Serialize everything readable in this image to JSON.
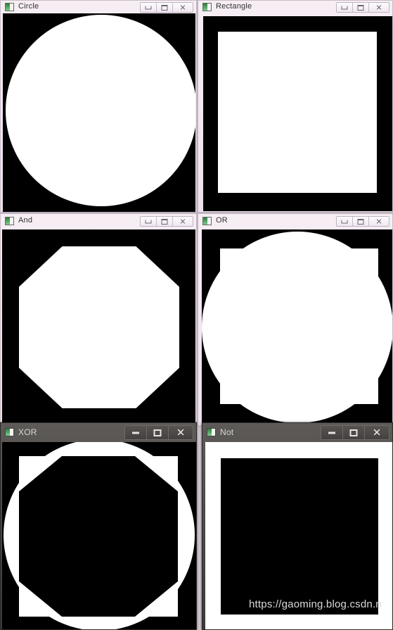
{
  "desktop": {
    "background_color": "#cfc6cf",
    "gap_color": "#bdb2bd"
  },
  "watermark": {
    "text": "https://gaoming.blog.csdn.n",
    "color": "#d9d9d9"
  },
  "caption_glyphs": {
    "minimize": "minimize-icon",
    "maximize": "maximize-icon",
    "close": "✕"
  },
  "windows": [
    {
      "id": "circle",
      "title": "Circle",
      "icon": "image-window-icon",
      "state": "inactive",
      "theme": "light",
      "canvas_background": "#000000",
      "shape": {
        "kind": "circle",
        "fill": "#ffffff"
      },
      "buttons": {
        "minimize": "Minimize",
        "maximize": "Maximize",
        "close": "Close"
      }
    },
    {
      "id": "rectangle",
      "title": "Rectangle",
      "icon": "image-window-icon",
      "state": "inactive",
      "theme": "light",
      "canvas_background": "#000000",
      "shape": {
        "kind": "rectangle",
        "fill": "#ffffff"
      },
      "buttons": {
        "minimize": "Minimize",
        "maximize": "Maximize",
        "close": "Close"
      }
    },
    {
      "id": "and",
      "title": "And",
      "icon": "image-window-icon",
      "state": "inactive",
      "theme": "light",
      "canvas_background": "#000000",
      "shape": {
        "kind": "intersection",
        "fill": "#ffffff"
      },
      "buttons": {
        "minimize": "Minimize",
        "maximize": "Maximize",
        "close": "Close"
      }
    },
    {
      "id": "or",
      "title": "OR",
      "icon": "image-window-icon",
      "state": "inactive",
      "theme": "light",
      "canvas_background": "#000000",
      "shape": {
        "kind": "union",
        "fill": "#ffffff"
      },
      "buttons": {
        "minimize": "Minimize",
        "maximize": "Maximize",
        "close": "Close"
      }
    },
    {
      "id": "xor",
      "title": "XOR",
      "icon": "image-window-icon",
      "state": "active",
      "theme": "dark",
      "canvas_background": "#000000",
      "shape": {
        "kind": "symmetric-difference",
        "fill": "#ffffff"
      },
      "buttons": {
        "minimize": "Minimize",
        "maximize": "Maximize",
        "close": "Close"
      }
    },
    {
      "id": "not",
      "title": "Not",
      "icon": "image-window-icon",
      "state": "active",
      "theme": "dark",
      "canvas_background": "#ffffff",
      "shape": {
        "kind": "inverted-rectangle",
        "fill": "#000000"
      },
      "buttons": {
        "minimize": "Minimize",
        "maximize": "Maximize",
        "close": "Close"
      }
    }
  ]
}
